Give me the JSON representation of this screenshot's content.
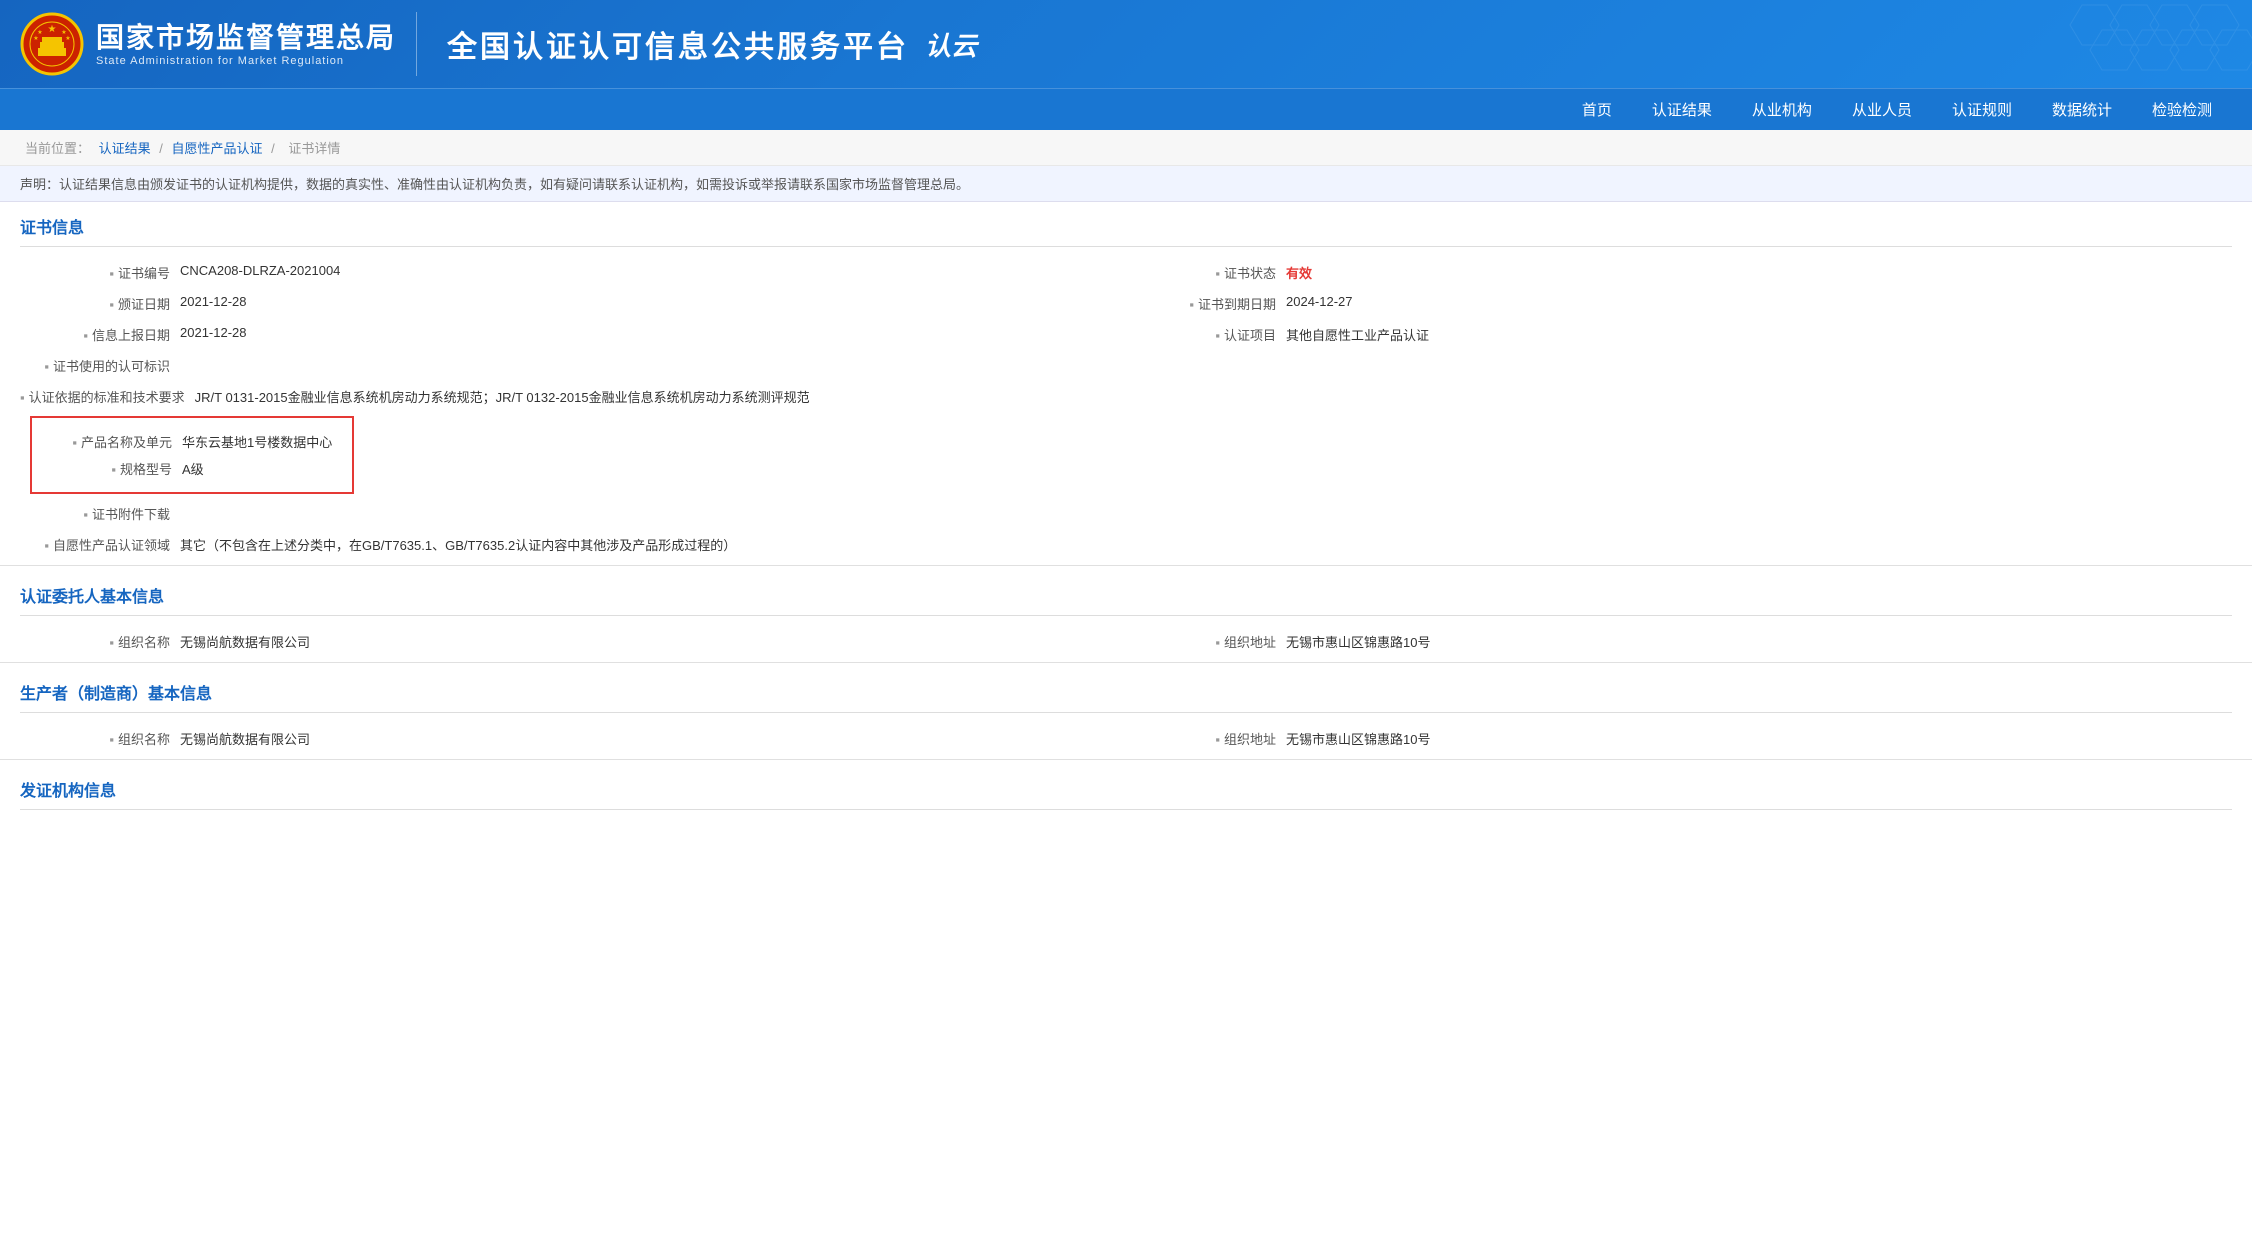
{
  "header": {
    "title_cn": "国家市场监督管理总局",
    "title_en": "State Administration for Market Regulation",
    "platform_text": "全国认证认可信息公共服务平台",
    "platform_logo": "认云"
  },
  "navbar": {
    "items": [
      {
        "label": "首页"
      },
      {
        "label": "认证结果"
      },
      {
        "label": "从业机构"
      },
      {
        "label": "从业人员"
      },
      {
        "label": "认证规则"
      },
      {
        "label": "数据统计"
      },
      {
        "label": "检验检测"
      }
    ]
  },
  "breadcrumb": {
    "prefix": "当前位置：",
    "items": [
      {
        "label": "认证结果",
        "link": true
      },
      {
        "label": "自愿性产品认证",
        "link": true
      },
      {
        "label": "证书详情",
        "link": false
      }
    ],
    "separator": "/"
  },
  "notice": "声明：认证结果信息由颁发证书的认证机构提供，数据的真实性、准确性由认证机构负责，如有疑问请联系认证机构，如需投诉或举报请联系国家市场监督管理总局。",
  "cert_section": {
    "title": "证书信息",
    "fields": [
      {
        "label": "证书编号",
        "value": "CNCA208-DLRZA-2021004",
        "right_label": "证书状态",
        "right_value": "有效"
      },
      {
        "label": "颁证日期",
        "value": "2021-12-28",
        "right_label": "证书到期日期",
        "right_value": "2024-12-27"
      },
      {
        "label": "信息上报日期",
        "value": "2021-12-28",
        "right_label": "认证项目",
        "right_value": "其他自愿性工业产品认证"
      },
      {
        "label": "证书使用的认可标识",
        "value": ""
      },
      {
        "label": "认证依据的标准和技术要求",
        "value": "JR/T 0131-2015金融业信息系统机房动力系统规范；JR/T 0132-2015金融业信息系统机房动力系统测评规范"
      },
      {
        "label": "产品名称及单元",
        "value": "华东云基地1号楼数据中心",
        "highlighted": true
      },
      {
        "label": "规格型号",
        "value": "A级",
        "highlighted": true
      },
      {
        "label": "证书附件下载",
        "value": "",
        "is_link": true
      },
      {
        "label": "自愿性产品认证领域",
        "value": "其它（不包含在上述分类中，在GB/T7635.1、GB/T7635.2认证内容中其他涉及产品形成过程的）"
      }
    ]
  },
  "client_section": {
    "title": "认证委托人基本信息",
    "fields": [
      {
        "label": "组织名称",
        "value": "无锡尚航数据有限公司",
        "right_label": "组织地址",
        "right_value": "无锡市惠山区锦惠路10号"
      }
    ]
  },
  "manufacturer_section": {
    "title": "生产者（制造商）基本信息",
    "fields": [
      {
        "label": "组织名称",
        "value": "无锡尚航数据有限公司",
        "right_label": "组织地址",
        "right_value": "无锡市惠山区锦惠路10号"
      }
    ]
  },
  "issuer_section": {
    "title": "发证机构信息"
  }
}
